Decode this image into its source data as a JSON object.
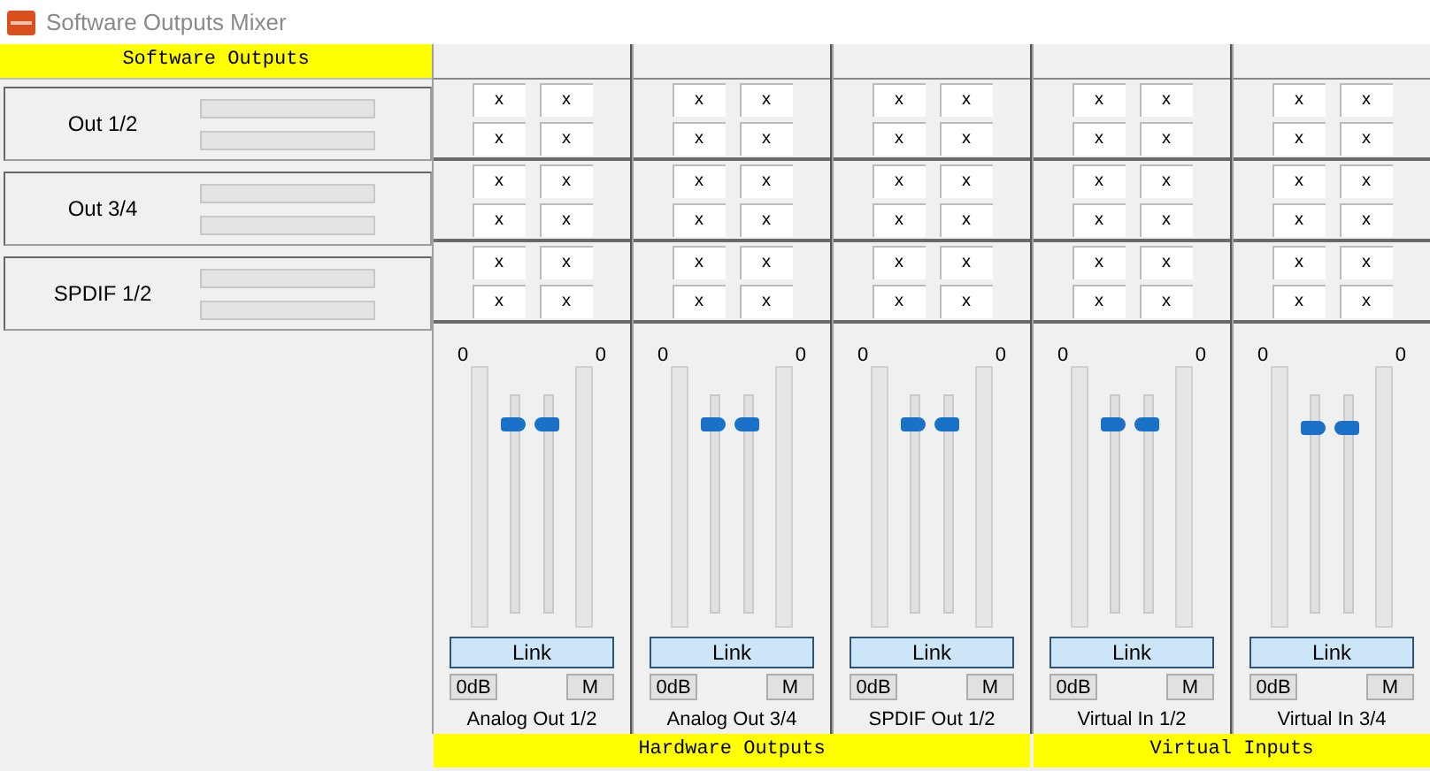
{
  "window": {
    "title": "Software Outputs Mixer"
  },
  "software_outputs": {
    "header": "Software Outputs",
    "rows": [
      {
        "label": "Out 1/2"
      },
      {
        "label": "Out 3/4"
      },
      {
        "label": "SPDIF 1/2"
      }
    ]
  },
  "groups": [
    {
      "label": "Hardware Outputs",
      "channels": [
        {
          "name": "Analog Out 1/2",
          "matrix": [
            [
              "x",
              "x",
              "x",
              "x"
            ],
            [
              "x",
              "x",
              "x",
              "x"
            ],
            [
              "x",
              "x",
              "x",
              "x"
            ]
          ],
          "left_value": "0",
          "right_value": "0",
          "left_fader": {
            "level": 0.87
          },
          "right_fader": {
            "level": 0.87
          },
          "link": "Link",
          "zero_db": "0dB",
          "mute": "M"
        },
        {
          "name": "Analog Out 3/4",
          "matrix": [
            [
              "x",
              "x",
              "x",
              "x"
            ],
            [
              "x",
              "x",
              "x",
              "x"
            ],
            [
              "x",
              "x",
              "x",
              "x"
            ]
          ],
          "left_value": "0",
          "right_value": "0",
          "left_fader": {
            "level": 0.87
          },
          "right_fader": {
            "level": 0.87
          },
          "link": "Link",
          "zero_db": "0dB",
          "mute": "M"
        },
        {
          "name": "SPDIF Out 1/2",
          "matrix": [
            [
              "x",
              "x",
              "x",
              "x"
            ],
            [
              "x",
              "x",
              "x",
              "x"
            ],
            [
              "x",
              "x",
              "x",
              "x"
            ]
          ],
          "left_value": "0",
          "right_value": "0",
          "left_fader": {
            "level": 0.87
          },
          "right_fader": {
            "level": 0.87
          },
          "link": "Link",
          "zero_db": "0dB",
          "mute": "M"
        }
      ]
    },
    {
      "label": "Virtual Inputs",
      "channels": [
        {
          "name": "Virtual In 1/2",
          "matrix": [
            [
              "x",
              "x",
              "x",
              "x"
            ],
            [
              "x",
              "x",
              "x",
              "x"
            ],
            [
              "x",
              "x",
              "x",
              "x"
            ]
          ],
          "left_value": "0",
          "right_value": "0",
          "left_fader": {
            "level": 0.87
          },
          "right_fader": {
            "level": 0.87
          },
          "link": "Link",
          "zero_db": "0dB",
          "mute": "M"
        },
        {
          "name": "Virtual In 3/4",
          "matrix": [
            [
              "x",
              "x",
              "x",
              "x"
            ],
            [
              "x",
              "x",
              "x",
              "x"
            ],
            [
              "x",
              "x",
              "x",
              "x"
            ]
          ],
          "left_value": "0",
          "right_value": "0",
          "left_fader": {
            "level": 0.85
          },
          "right_fader": {
            "level": 0.85
          },
          "link": "Link",
          "zero_db": "0dB",
          "mute": "M"
        }
      ]
    }
  ]
}
